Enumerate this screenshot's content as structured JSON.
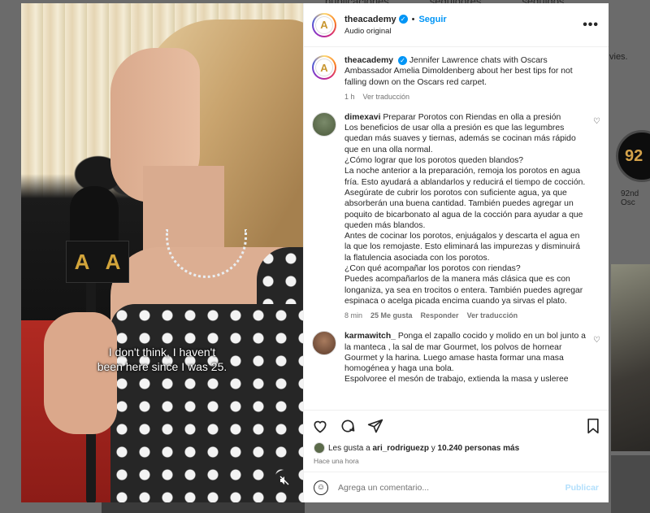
{
  "background": {
    "stats": [
      "publicaciones",
      "seguidores",
      "seguidos"
    ],
    "movies_fragment": "vies.",
    "highlight_badge": "92",
    "highlight_label": "92nd Osc"
  },
  "post": {
    "subtitle_line1": "I don't think, I haven't",
    "subtitle_line2": "been here since I was 25.",
    "mic_logo": [
      "A",
      "A"
    ]
  },
  "header": {
    "username": "theacademy",
    "follow_label": "Seguir",
    "audio_label": "Audio original",
    "more_label": "•••"
  },
  "caption": {
    "username": "theacademy",
    "text": "Jennifer Lawrence chats with Oscars Ambassador Amelia Dimoldenberg about her best tips for not falling down on the Oscars red carpet.",
    "time": "1 h",
    "translate": "Ver traducción"
  },
  "comments": [
    {
      "username": "dimexavi",
      "lines": [
        "Preparar Porotos con Riendas en olla a presión",
        "Los beneficios de usar olla a presión es que las legumbres quedan más suaves y tiernas, además se cocinan más rápido que en una olla normal.",
        "¿Cómo lograr que los porotos queden blandos?",
        "La noche anterior a la preparación, remoja los porotos en agua fría. Esto ayudará a ablandarlos y reducirá el tiempo de cocción. Asegúrate de cubrir los porotos con suficiente agua, ya que absorberán una buena cantidad. También puedes agregar un poquito de bicarbonato al agua de la cocción para ayudar a que queden más blandos.",
        "Antes de cocinar los porotos, enjuágalos y descarta el agua en la que los remojaste. Esto eliminará las impurezas y disminuirá la flatulencia asociada con los porotos.",
        "¿Con qué acompañar los porotos con riendas?",
        "Puedes acompañarlos de la manera más clásica que es con longaniza, ya sea en trocitos o entera. También puedes agregar espinaca o acelga picada encima cuando ya sirvas el plato."
      ],
      "time": "8 min",
      "likes": "25 Me gusta",
      "reply": "Responder",
      "translate": "Ver traducción"
    },
    {
      "username": "karmawitch_",
      "lines": [
        "Ponga el zapallo cocido y molido en un bol junto a la manteca , la sal de mar Gourmet, los polvos de hornear Gourmet y la harina. Luego amase hasta formar una masa homogénea y haga una bola.",
        "Espolvoree el mesón de trabajo, extienda la masa y usleree"
      ]
    }
  ],
  "likes": {
    "prefix": "Les gusta a",
    "user": "ari_rodriguezp",
    "middle": "y",
    "count": "10.240 personas más"
  },
  "timestamp": "Hace una hora",
  "composer": {
    "placeholder": "Agrega un comentario...",
    "post_label": "Publicar"
  }
}
